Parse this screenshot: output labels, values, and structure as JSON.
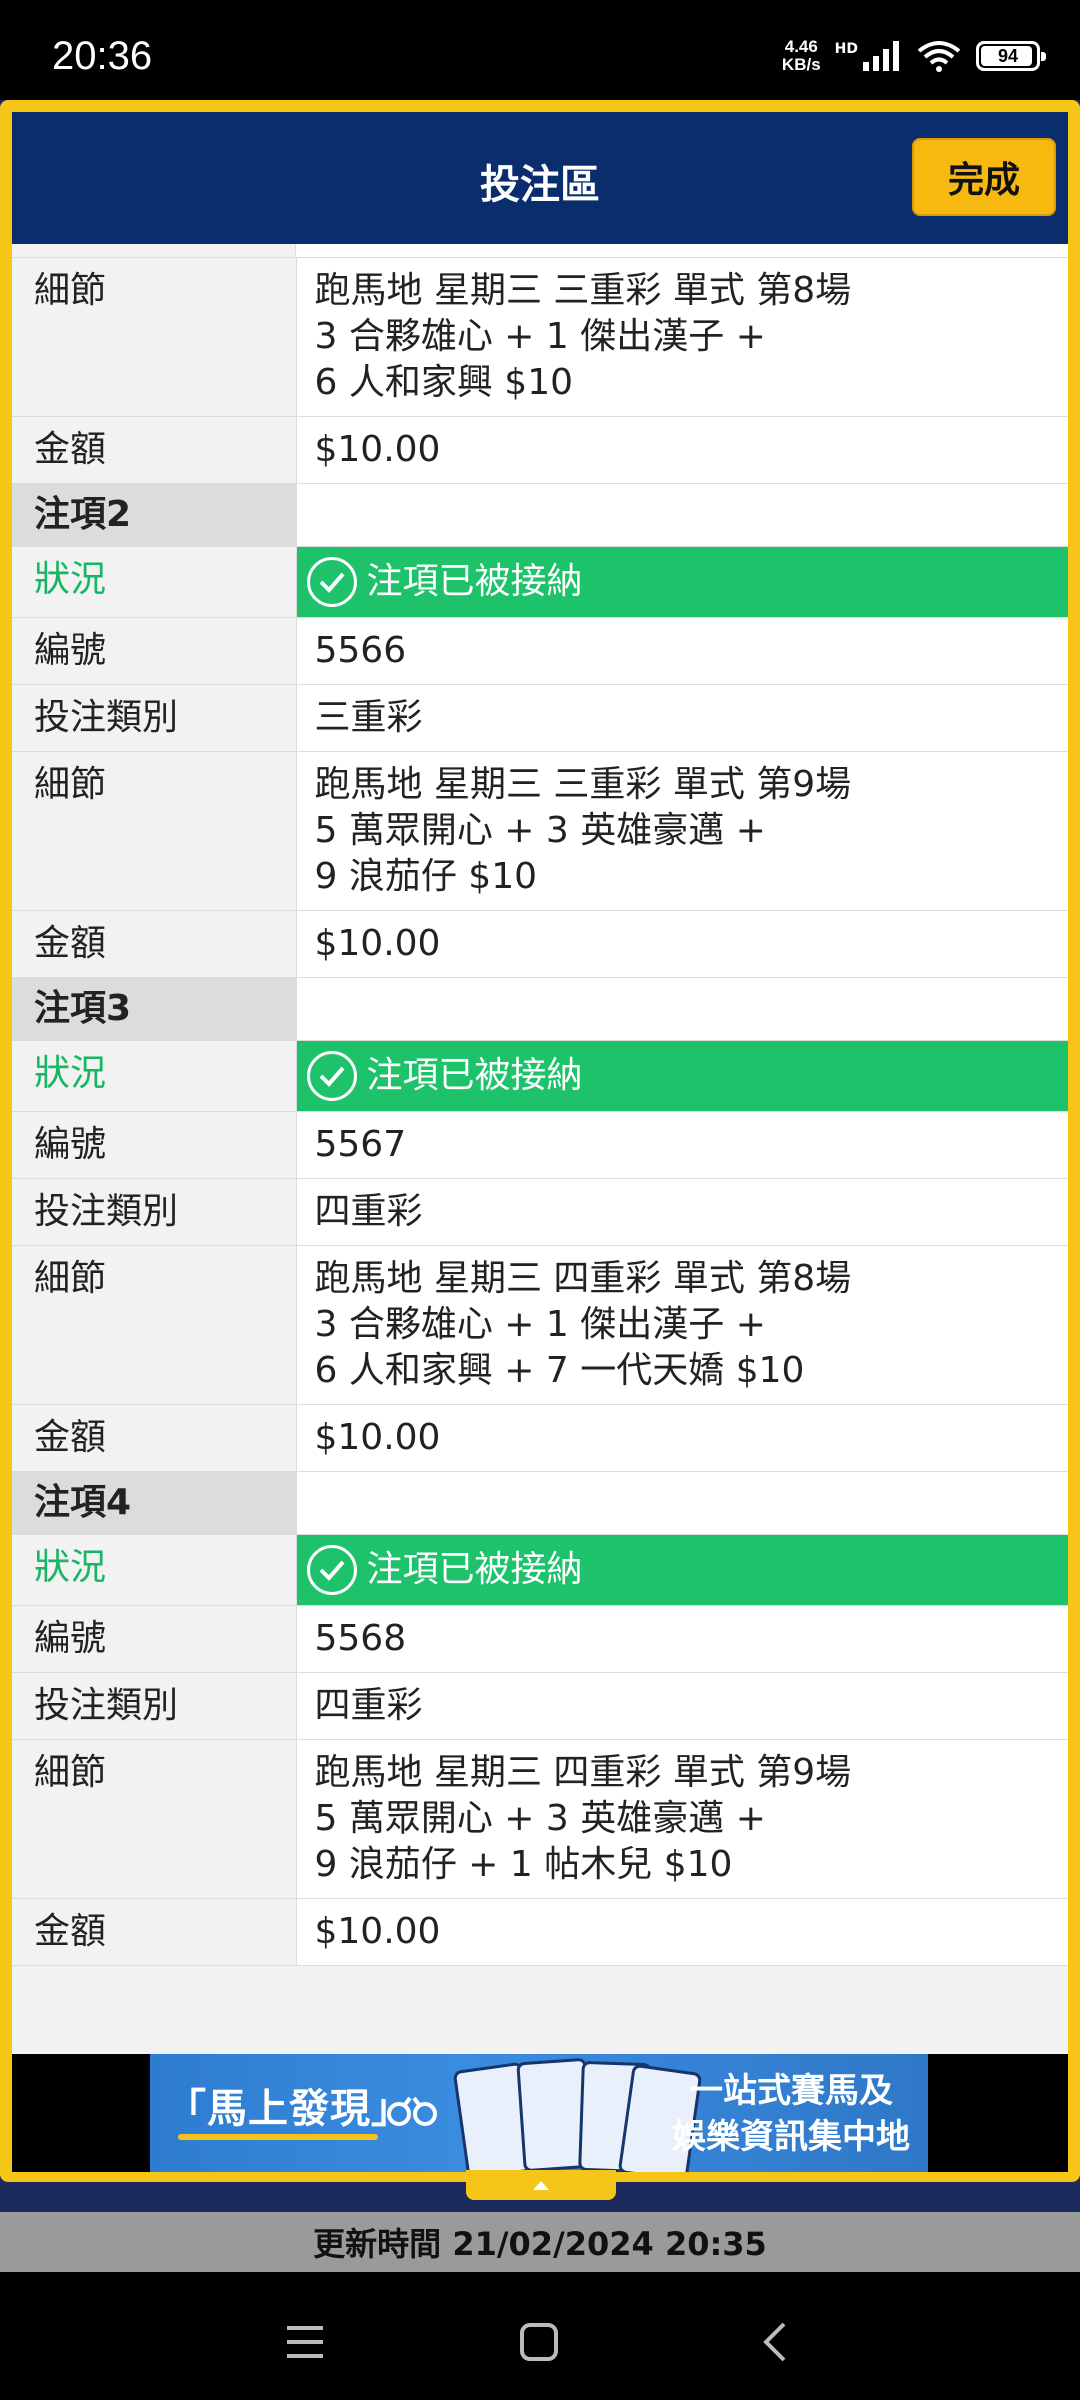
{
  "status_bar": {
    "time": "20:36",
    "net_speed_value": "4.46",
    "net_speed_unit": "KB/s",
    "hd": "HD",
    "battery": "94",
    "battery_level": 0.94
  },
  "modal": {
    "title": "投注區",
    "done_label": "完成"
  },
  "labels": {
    "details": "細節",
    "amount": "金額",
    "status": "狀況",
    "number": "編號",
    "bet_type": "投注類別"
  },
  "bet1_partial": {
    "details": [
      "跑馬地 星期三 三重彩 單式 第8場",
      "3 合夥雄心 + 1 傑出漢子 +",
      "6 人和家興 $10"
    ],
    "amount": "$10.00"
  },
  "bets": [
    {
      "title": "注項2",
      "status": "注項已被接納",
      "number": "5566",
      "type": "三重彩",
      "details": [
        "跑馬地 星期三 三重彩 單式 第9場",
        "5 萬眾開心 + 3 英雄豪邁 +",
        "9 浪茄仔 $10"
      ],
      "amount": "$10.00"
    },
    {
      "title": "注項3",
      "status": "注項已被接納",
      "number": "5567",
      "type": "四重彩",
      "details": [
        "跑馬地 星期三 四重彩 單式 第8場",
        "3 合夥雄心 + 1 傑出漢子 +",
        "6 人和家興 + 7 一代天嬌 $10"
      ],
      "amount": "$10.00"
    },
    {
      "title": "注項4",
      "status": "注項已被接納",
      "number": "5568",
      "type": "四重彩",
      "details": [
        "跑馬地 星期三 四重彩 單式 第9場",
        "5 萬眾開心 + 3 英雄豪邁 +",
        "9 浪茄仔 + 1 帖木兒 $10"
      ],
      "amount": "$10.00"
    }
  ],
  "banner": {
    "left_text": "「馬上發現」",
    "right_line1": "一站式賽馬及",
    "right_line2": "娛樂資訊集中地"
  },
  "footer": {
    "update_time": "更新時間 21/02/2024 20:35"
  },
  "colors": {
    "header_navy": "#0a2d6e",
    "accent_yellow": "#f7b90f",
    "accepted_green": "#1ec26b"
  }
}
